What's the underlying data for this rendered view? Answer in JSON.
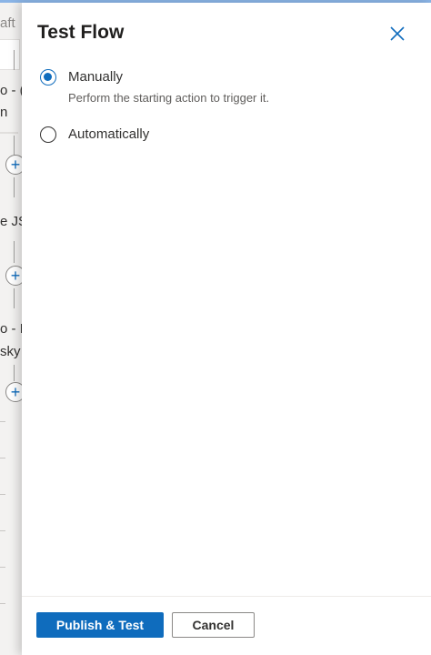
{
  "background_canvas": {
    "fragments": [
      "aft",
      "o - (",
      "n",
      "e JS",
      "o - I",
      "sky"
    ]
  },
  "panel": {
    "title": "Test Flow",
    "close_icon": "close-icon",
    "options": [
      {
        "label": "Manually",
        "description": "Perform the starting action to trigger it.",
        "checked": true
      },
      {
        "label": "Automatically",
        "checked": false
      }
    ]
  },
  "footer": {
    "primary_label": "Publish & Test",
    "secondary_label": "Cancel"
  },
  "colors": {
    "accent": "#0f6cbd",
    "text": "#323130"
  }
}
